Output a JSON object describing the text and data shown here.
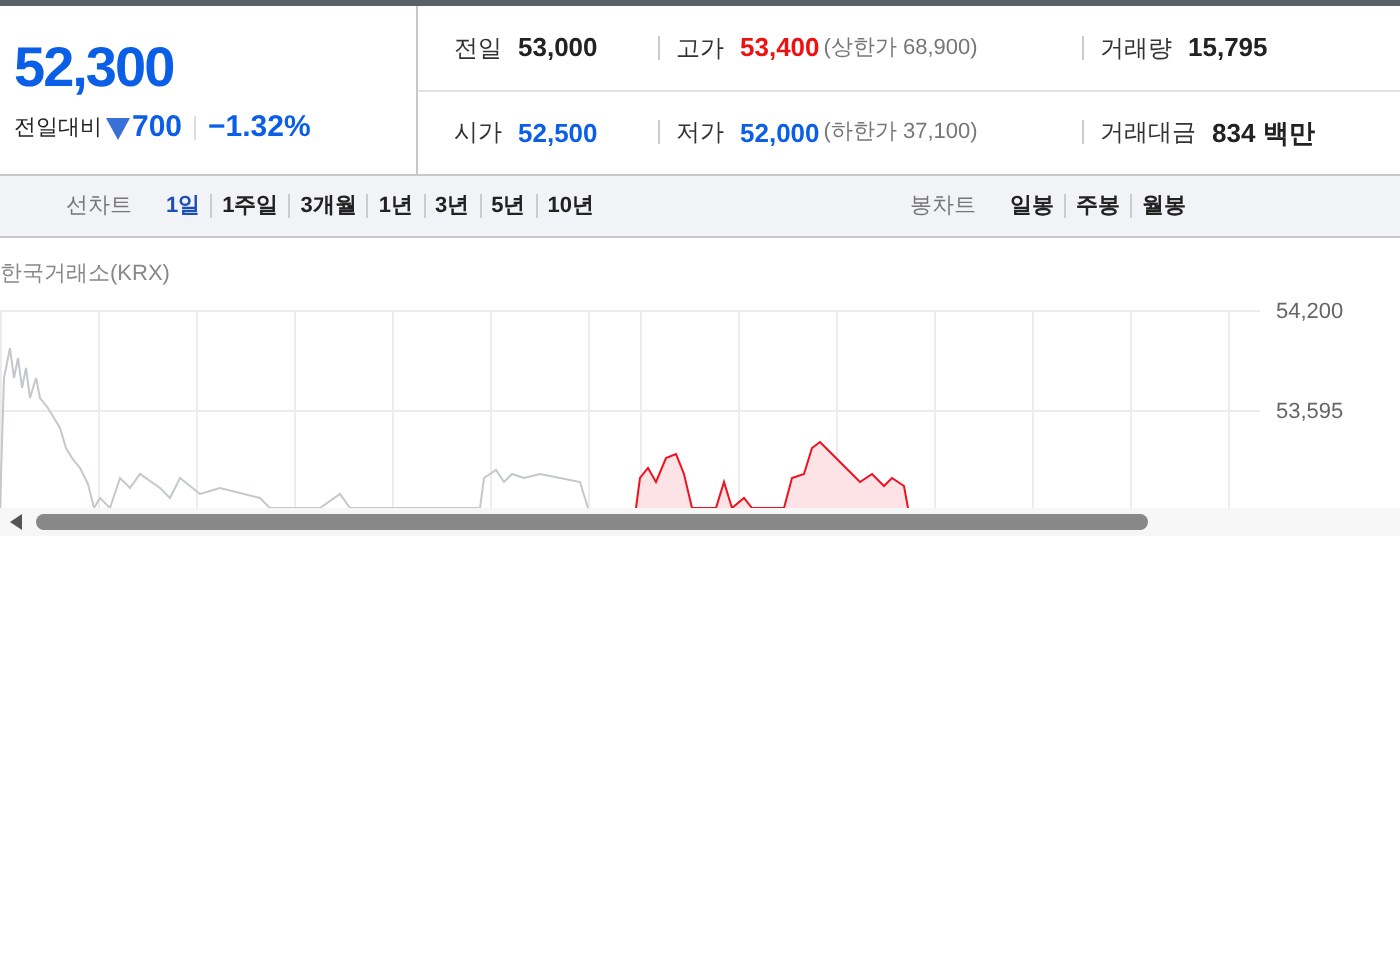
{
  "quote": {
    "price": "52,300",
    "change_label": "전일대비",
    "falling": true,
    "change": "700",
    "percent": "−1.32%"
  },
  "stats": [
    [
      {
        "label": "전일",
        "value": "53,000",
        "color": "#222222"
      },
      {
        "label": "고가",
        "value": "53,400",
        "color": "#f01010",
        "limit": "(상한가 68,900)"
      },
      {
        "label": "거래량",
        "value": "15,795",
        "color": "#222222"
      }
    ],
    [
      {
        "label": "시가",
        "value": "52,500",
        "color": "#0b5fe6"
      },
      {
        "label": "저가",
        "value": "52,000",
        "color": "#0b5fe6",
        "limit": "(하한가 37,100)"
      },
      {
        "label": "거래대금",
        "value": "834 백만",
        "color": "#222222"
      }
    ]
  ],
  "line_chart_tabs": {
    "label": "선차트",
    "items": [
      {
        "label": "1일",
        "selected": true
      },
      {
        "label": "1주일",
        "selected": false
      },
      {
        "label": "3개월",
        "selected": false
      },
      {
        "label": "1년",
        "selected": false
      },
      {
        "label": "3년",
        "selected": false
      },
      {
        "label": "5년",
        "selected": false
      },
      {
        "label": "10년",
        "selected": false
      }
    ]
  },
  "candle_chart_tabs": {
    "label": "봉차트",
    "items": [
      {
        "label": "일봉",
        "selected": false
      },
      {
        "label": "주봉",
        "selected": false
      },
      {
        "label": "월봉",
        "selected": false
      }
    ]
  },
  "chart": {
    "exchange": "한국거래소(KRX)",
    "y_labels": [
      "54,200",
      "53,595"
    ]
  }
}
